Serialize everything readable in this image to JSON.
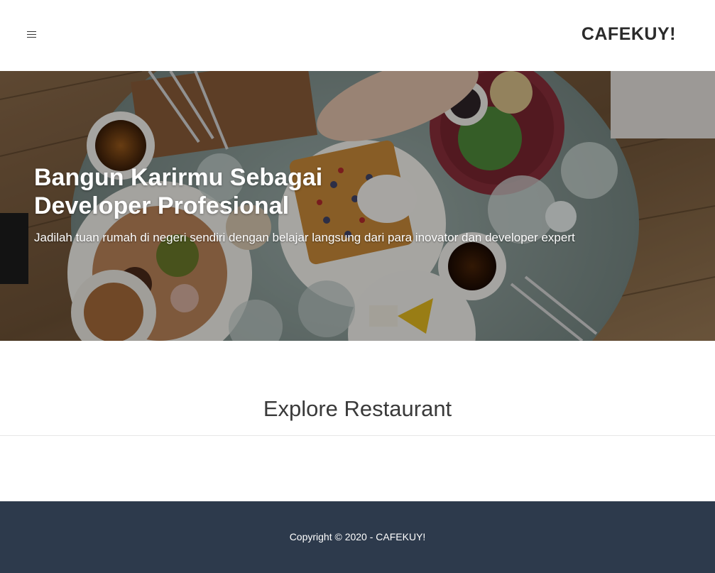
{
  "header": {
    "brand": "CAFEKUY!",
    "menu_icon": "hamburger-menu-icon"
  },
  "hero": {
    "title": "Bangun Karirmu Sebagai Developer Profesional",
    "subtitle": "Jadilah tuan rumah di negeri sendiri dengan belajar langsung dari para inovator dan developer expert"
  },
  "explore": {
    "title": "Explore Restaurant"
  },
  "footer": {
    "copyright": "Copyright © 2020 - CAFEKUY!"
  },
  "colors": {
    "footer_bg": "#2d3a4c",
    "brand_text": "#2b2b2b",
    "hero_text": "#ffffff"
  }
}
